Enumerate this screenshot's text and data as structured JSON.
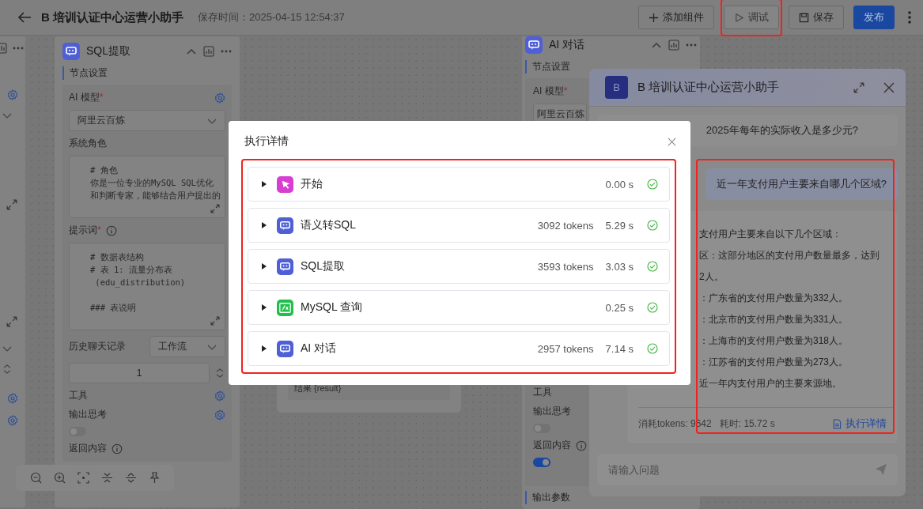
{
  "header": {
    "title": "B 培训认证中心运营小助手",
    "saved_time": "保存时间：2025-04-15 12:54:37",
    "buttons": [
      {
        "kind": "add",
        "label": "添加组件",
        "disabled": false,
        "highlighted": false
      },
      {
        "kind": "debug",
        "label": "调试",
        "disabled": true,
        "highlighted": true
      },
      {
        "kind": "save",
        "label": "保存",
        "disabled": false,
        "highlighted": false
      },
      {
        "kind": "primary",
        "label": "发布",
        "disabled": false,
        "highlighted": false
      }
    ]
  },
  "sql_node": {
    "title": "SQL提取",
    "section": "节点设置",
    "model_label": "AI 模型",
    "model_required": "*",
    "model_value": "阿里云百炼",
    "role_label": "系统角色",
    "role_text": [
      "# 角色",
      "你是一位专业的MySQL SQL优化",
      "和判断专家，能够结合用户提出的"
    ],
    "prompt_label": "提示词",
    "prompt_required": "*",
    "prompt_text": [
      [
        "# 数据表结构",
        "# 表 1: 流量分布表",
        " (edu_distribution)"
      ],
      [
        "### 表说明"
      ]
    ],
    "history_label": "历史聊天记录",
    "history_value": "工作流",
    "count_value": "1",
    "tools_label": "工具",
    "thinking_label": "输出思考",
    "thinking_on": false,
    "return_label": "返回内容"
  },
  "canvas_node": {
    "result": "结果 {result}"
  },
  "ai_node": {
    "title": "AI 对话",
    "section": "节点设置",
    "model_label": "AI 模型",
    "model_required": "*",
    "model_value": "阿里云百炼",
    "tools_label": "工具",
    "thinking_label": "输出思考",
    "thinking_on": false,
    "return_label": "返回内容",
    "return_on": true,
    "output_label": "输出参数"
  },
  "chat": {
    "avatar": "B",
    "title": "B 培训认证中心运营小助手",
    "highlighted": true,
    "messages": [
      {
        "kind": "question",
        "text": "2025年每年的实际收入是多少元?"
      },
      {
        "kind": "question",
        "text": "近一年支付用户主要来自哪几个区域?"
      },
      {
        "kind": "answer",
        "lines": [
          "支付用户主要来自以下几个区域：",
          "区：这部分地区的支付用户数量最多，达到",
          "2人。",
          "：广东省的支付用户数量为332人。",
          "：北京市的支付用户数量为331人。",
          "：上海市的支付用户数量为318人。",
          "：江苏省的支付用户数量为273人。",
          "近一年内支付用户的主要来源地。"
        ],
        "tokens": "消耗tokens: 9642",
        "duration": "耗时: 15.72 s",
        "link": "执行详情"
      }
    ],
    "input_placeholder": "请输入问题"
  },
  "modal": {
    "title": "执行详情",
    "highlighted": true,
    "steps": [
      {
        "kind": "start",
        "name": "开始",
        "time": "0.00 s",
        "expanded": false,
        "success": true
      },
      {
        "kind": "llm",
        "name": "语义转SQL",
        "tokens": "3092 tokens",
        "time": "5.29 s",
        "expanded": false,
        "success": true
      },
      {
        "kind": "llm",
        "name": "SQL提取",
        "tokens": "3593 tokens",
        "time": "3.03 s",
        "expanded": false,
        "success": true
      },
      {
        "kind": "function",
        "name": "MySQL 查询",
        "time": "0.25 s",
        "expanded": false,
        "success": true
      },
      {
        "kind": "llm",
        "name": "AI 对话",
        "tokens": "2957 tokens",
        "time": "7.14 s",
        "expanded": false,
        "success": true
      }
    ]
  }
}
